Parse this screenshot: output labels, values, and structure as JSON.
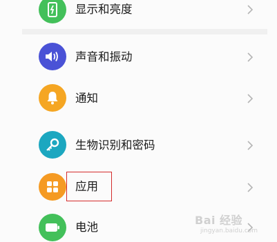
{
  "settings_list": {
    "items": [
      {
        "label": "显示和亮度",
        "icon": "display-brightness-icon",
        "color": "#43c05a"
      },
      {
        "label": "声音和振动",
        "icon": "speaker-icon",
        "color": "#4a52d6"
      },
      {
        "label": "通知",
        "icon": "bell-icon",
        "color": "#f5a623"
      },
      {
        "label": "生物识别和密码",
        "icon": "key-icon",
        "color": "#1ca7c0"
      },
      {
        "label": "应用",
        "icon": "apps-grid-icon",
        "color": "#f59a23"
      },
      {
        "label": "电池",
        "icon": "battery-icon",
        "color": "#43c05a"
      }
    ]
  },
  "highlight_color": "#d42a2a",
  "watermark": {
    "text": "Bai 经验",
    "sub": "jingyan.baidu.com"
  }
}
